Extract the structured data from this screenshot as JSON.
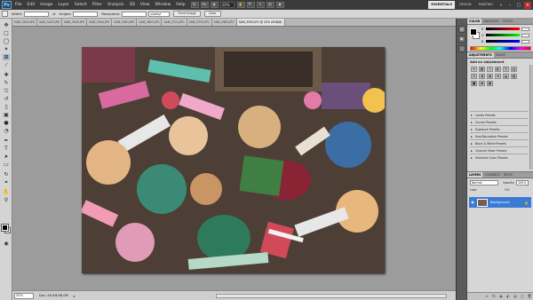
{
  "app": {
    "logo": "Ps",
    "menu": [
      "File",
      "Edit",
      "Image",
      "Layer",
      "Select",
      "Filter",
      "Analysis",
      "3D",
      "View",
      "Window",
      "Help"
    ],
    "zoom": "33%",
    "workspaces": [
      "ESSENTIALS",
      "DESIGN",
      "PAINTING"
    ],
    "active_workspace": "ESSENTIALS"
  },
  "options_bar": {
    "width_label": "Width:",
    "height_label": "Height:",
    "resolution_label": "Resolution:",
    "units": "pixels/i",
    "front_image_button": "Front Image",
    "clear_button": "Clear"
  },
  "tabs": [
    {
      "label": "SAM_3420.JPG",
      "active": false
    },
    {
      "label": "SAM_3423.JPG",
      "active": false
    },
    {
      "label": "SAM_3530.JPG",
      "active": false
    },
    {
      "label": "SAM_3544.JPG",
      "active": false
    },
    {
      "label": "SAM_3561.JPG",
      "active": false
    },
    {
      "label": "SAM_3622.JPG",
      "active": false
    },
    {
      "label": "SAM_3721.JPG",
      "active": false
    },
    {
      "label": "SAM_3732.JPG",
      "active": false
    },
    {
      "label": "SAM_3962.JPG",
      "active": false
    },
    {
      "label": "SAM_3953.JPG @ 25% (RGB/8)",
      "active": true
    }
  ],
  "status": {
    "zoom": "25%",
    "doc": "Doc: 48.0M/48.0M"
  },
  "color_panel": {
    "tabs": [
      "COLOR",
      "SWATCHES",
      "STYLES"
    ],
    "r": "R",
    "g": "G",
    "b": "B"
  },
  "adjustments_panel": {
    "tabs": [
      "ADJUSTMENTS",
      "MASKS"
    ],
    "title": "Add an adjustment",
    "presets": [
      "Levels Presets",
      "Curves Presets",
      "Exposure Presets",
      "Hue/Saturation Presets",
      "Black & White Presets",
      "Channel Mixer Presets",
      "Selective Color Presets"
    ]
  },
  "layers_panel": {
    "tabs": [
      "LAYERS",
      "CHANNELS",
      "PATHS"
    ],
    "blend_mode": "Normal",
    "opacity_label": "Opacity:",
    "opacity_value": "100%",
    "lock_label": "Lock:",
    "fill_label": "Fill:",
    "layer_name": "Background"
  },
  "colors": {
    "app_bar": "#3b3b3b",
    "doc_bg": "#9c9c9c",
    "panel_bg": "#d6d6d6",
    "layer_selected": "#3a7bd5"
  }
}
